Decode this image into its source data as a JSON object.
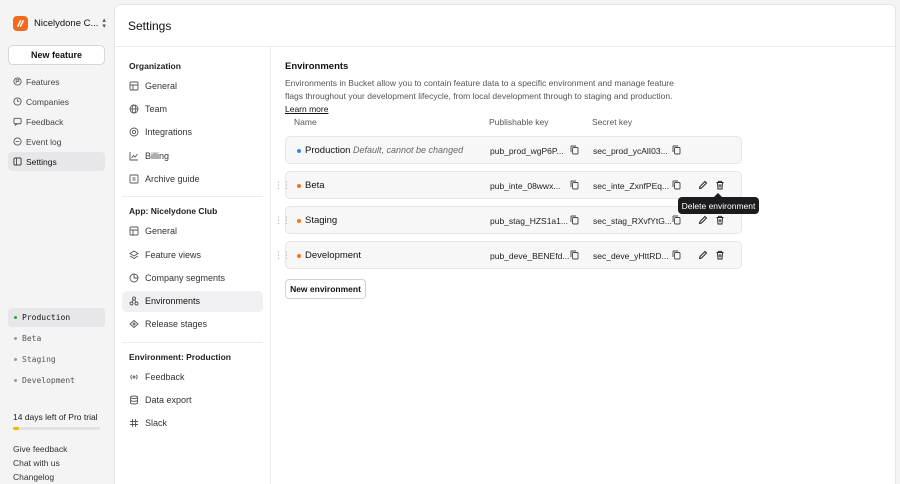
{
  "org": {
    "name": "Nicelydone C..."
  },
  "sidebar": {
    "new_feature": "New feature",
    "items": [
      {
        "label": "Features",
        "icon": "flag-icon"
      },
      {
        "label": "Companies",
        "icon": "companies-icon"
      },
      {
        "label": "Feedback",
        "icon": "feedback-icon"
      },
      {
        "label": "Event log",
        "icon": "event-log-icon"
      },
      {
        "label": "Settings",
        "icon": "settings-icon",
        "active": true
      }
    ],
    "environments": [
      {
        "label": "Production",
        "active": true
      },
      {
        "label": "Beta"
      },
      {
        "label": "Staging"
      },
      {
        "label": "Development"
      }
    ],
    "trial_text": "14 days left of Pro trial",
    "trial_progress": 0.07,
    "trial_color": "#f5b400",
    "footer": {
      "give_feedback": "Give feedback",
      "chat": "Chat with us",
      "changelog": "Changelog"
    }
  },
  "page": {
    "title": "Settings"
  },
  "settings_nav": {
    "org_heading": "Organization",
    "org_items": [
      "General",
      "Team",
      "Integrations",
      "Billing",
      "Archive guide"
    ],
    "app_heading": "App: Nicelydone Club",
    "app_items": [
      "General",
      "Feature views",
      "Company segments",
      "Environments",
      "Release stages"
    ],
    "env_heading": "Environment: Production",
    "env_items": [
      "Feedback",
      "Data export",
      "Slack"
    ]
  },
  "environments": {
    "title": "Environments",
    "description": "Environments in Bucket allow you to contain feature data to a specific environment and manage feature flags throughout your development lifecycle, from local development through to staging and production.",
    "learn_more": "Learn more",
    "columns": {
      "name": "Name",
      "publishable_key": "Publishable key",
      "secret_key": "Secret key"
    },
    "rows": [
      {
        "name": "Production",
        "note": "Default, cannot be changed",
        "pub": "pub_prod_wgP6P...",
        "sec": "sec_prod_ycAlI03...",
        "color": "#3b82f6"
      },
      {
        "name": "Beta",
        "pub": "pub_inte_08wwx...",
        "sec": "sec_inte_ZxnfPEq...",
        "color": "#f97316"
      },
      {
        "name": "Staging",
        "pub": "pub_stag_HZS1a1...",
        "sec": "sec_stag_RXvfYtG...",
        "color": "#f97316"
      },
      {
        "name": "Development",
        "pub": "pub_deve_BENEfd...",
        "sec": "sec_deve_yHttRD...",
        "color": "#f97316"
      }
    ],
    "new_button": "New environment",
    "tooltip": "Delete environment"
  }
}
